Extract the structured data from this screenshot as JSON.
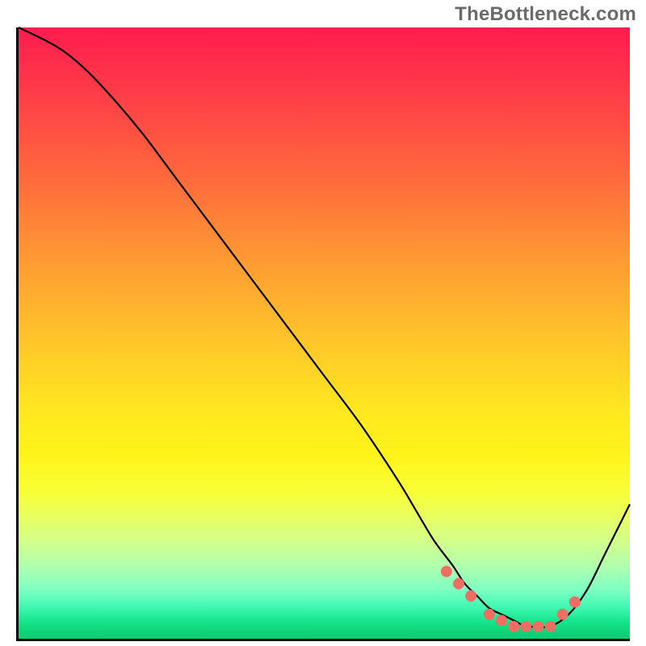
{
  "watermark": "TheBottleneck.com",
  "colors": {
    "line": "#000000",
    "dots": "#ee6e64",
    "axis": "#000000"
  },
  "chart_data": {
    "type": "line",
    "title": "",
    "xlabel": "",
    "ylabel": "",
    "xlim": [
      0,
      100
    ],
    "ylim": [
      0,
      100
    ],
    "grid": false,
    "legend": false,
    "series": [
      {
        "name": "bottleneck-curve",
        "x": [
          0,
          6,
          10,
          14,
          20,
          26,
          32,
          38,
          44,
          50,
          56,
          62,
          65,
          68,
          71,
          73,
          75,
          77,
          79,
          81,
          83,
          85,
          87,
          90,
          93,
          96,
          100
        ],
        "y": [
          100,
          97,
          94,
          90,
          83,
          75,
          67,
          59,
          51,
          43,
          35,
          26,
          21,
          16,
          12,
          9,
          7,
          5,
          4,
          3,
          2,
          2,
          2,
          4,
          8,
          14,
          22
        ]
      }
    ],
    "dots": {
      "name": "highlight-markers",
      "x": [
        70,
        72,
        74,
        77,
        79,
        81,
        83,
        85,
        87,
        89,
        91
      ],
      "y": [
        11,
        9,
        7,
        4,
        3,
        2,
        2,
        2,
        2,
        4,
        6
      ]
    }
  }
}
